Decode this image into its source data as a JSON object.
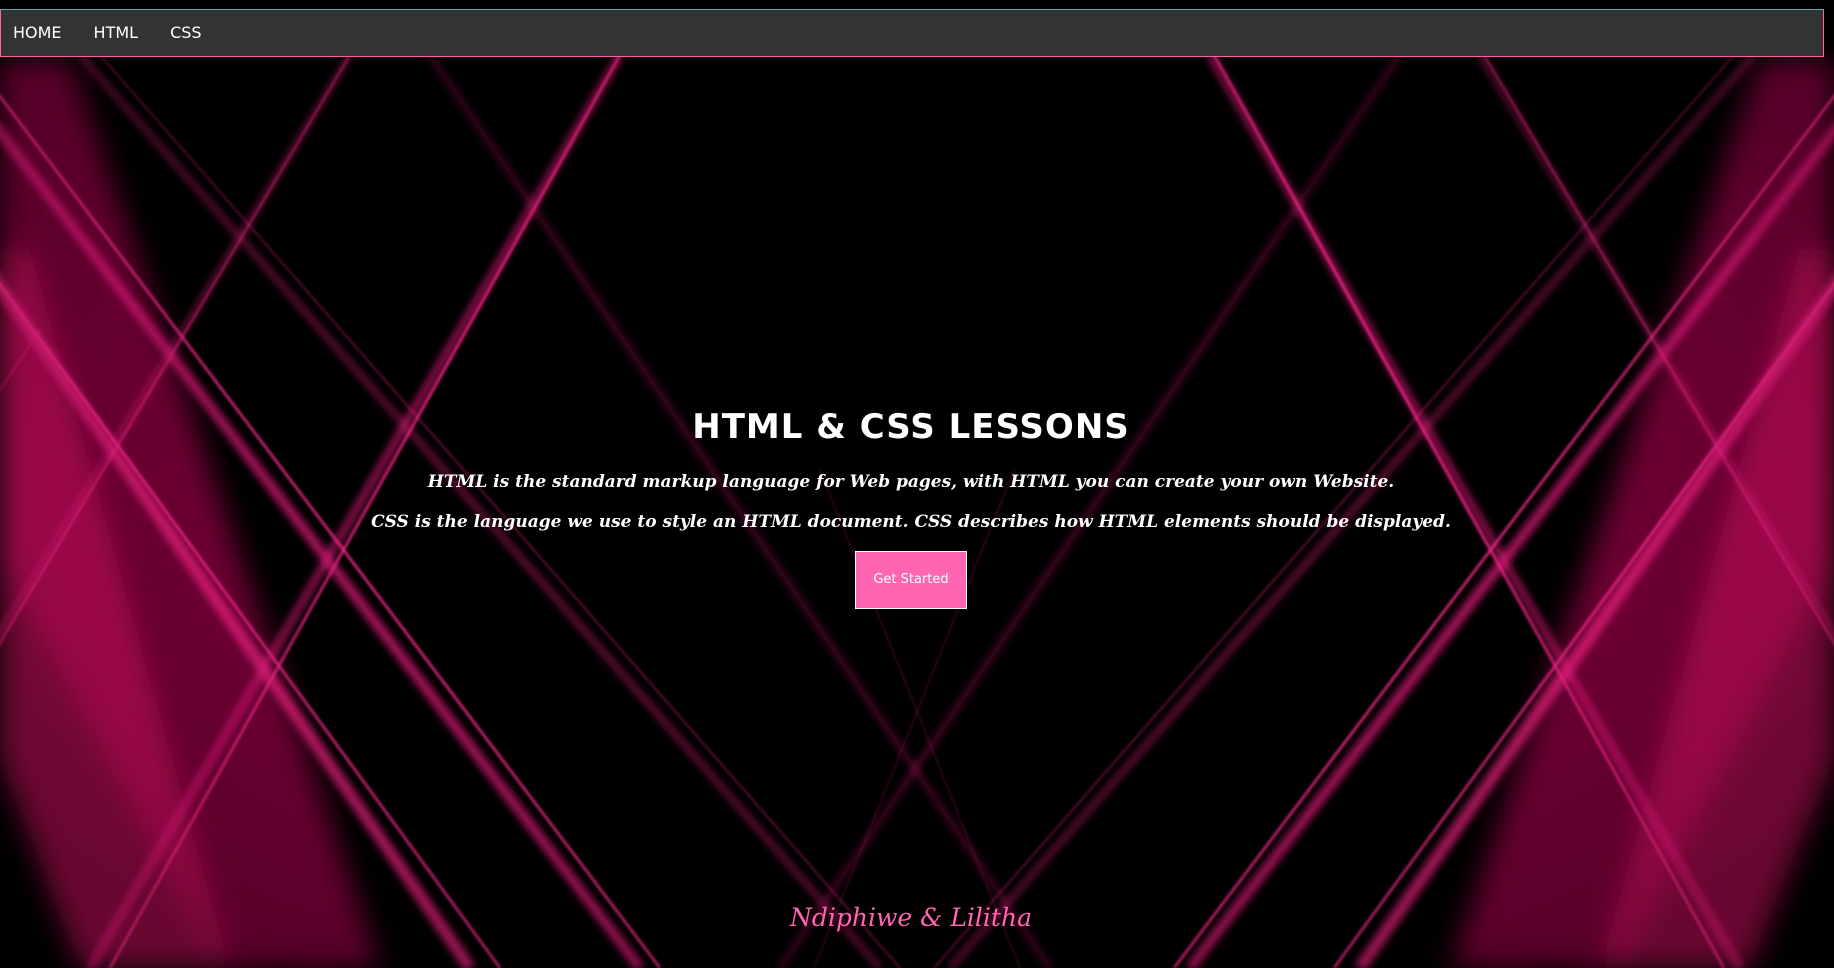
{
  "nav": {
    "items": [
      {
        "label": "HOME"
      },
      {
        "label": "HTML"
      },
      {
        "label": "CSS"
      }
    ]
  },
  "hero": {
    "title": "HTML & CSS LESSONS",
    "line1": "HTML is the standard markup language for Web pages, with HTML you can create your own Website.",
    "line2": "CSS is the language we use to style an HTML document. CSS describes how HTML elements should be displayed.",
    "button_label": "Get Started"
  },
  "footer": {
    "signature": "Ndiphiwe & Lilitha"
  },
  "colors": {
    "accent": "#ff66b2",
    "navbar_bg": "#333333",
    "background": "#000000",
    "glow": "#ff1f8a"
  }
}
